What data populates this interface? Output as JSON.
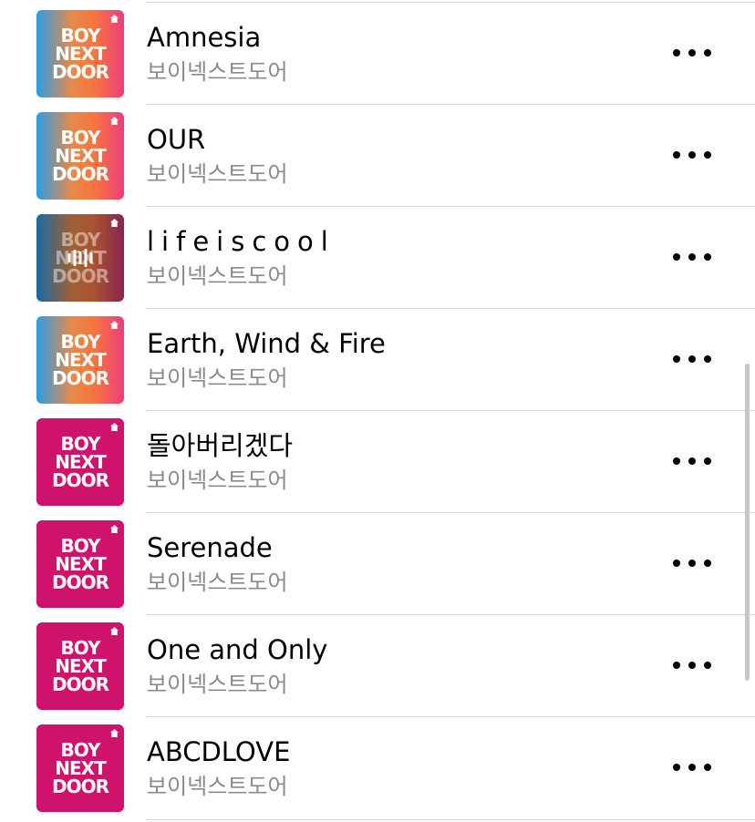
{
  "artwork_logo": [
    "BOY",
    "NEXT",
    "DOOR"
  ],
  "songs": [
    {
      "title": "Amnesia",
      "artist": "보이넥스트도어",
      "art": "gradient",
      "playing": false
    },
    {
      "title": "OUR",
      "artist": "보이넥스트도어",
      "art": "gradient",
      "playing": false
    },
    {
      "title": "lifeiscool",
      "artist": "보이넥스트도어",
      "art": "gradient-dim",
      "playing": true
    },
    {
      "title": "Earth, Wind & Fire",
      "artist": "보이넥스트도어",
      "art": "gradient",
      "playing": false
    },
    {
      "title": "돌아버리겠다",
      "artist": "보이넥스트도어",
      "art": "magenta",
      "playing": false
    },
    {
      "title": "Serenade",
      "artist": "보이넥스트도어",
      "art": "magenta",
      "playing": false
    },
    {
      "title": "One and Only",
      "artist": "보이넥스트도어",
      "art": "magenta",
      "playing": false
    },
    {
      "title": "ABCDLOVE",
      "artist": "보이넥스트도어",
      "art": "magenta",
      "playing": false
    }
  ],
  "icons": {
    "more": "more-ellipsis-icon",
    "badge": "home-badge-icon",
    "playing": "now-playing-icon"
  },
  "colors": {
    "title": "#000000",
    "subtitle": "#8a8a8e",
    "divider": "#d9d9db",
    "art_magenta": "#cf136c"
  }
}
